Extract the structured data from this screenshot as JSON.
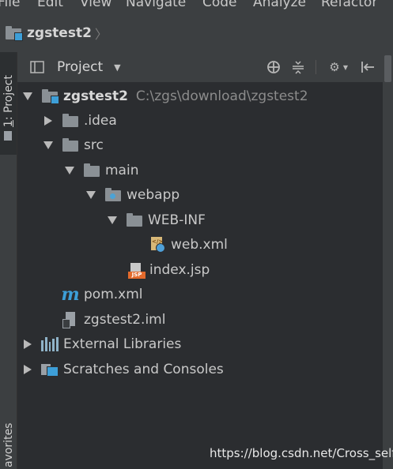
{
  "menu": [
    "File",
    "Edit",
    "View",
    "Navigate",
    "Code",
    "Analyze",
    "Refactor"
  ],
  "breadcrumb": {
    "label": "zgstest2"
  },
  "left_tabs": {
    "project_number": "1",
    "project_label": ": Project",
    "favorites_label": "avorites"
  },
  "panel": {
    "title": "Project"
  },
  "tree": [
    {
      "label": "zgstest2",
      "path": "C:\\zgs\\download\\zgstest2"
    },
    {
      "label": ".idea"
    },
    {
      "label": "src"
    },
    {
      "label": "main"
    },
    {
      "label": "webapp"
    },
    {
      "label": "WEB-INF"
    },
    {
      "label": "web.xml"
    },
    {
      "label": "index.jsp"
    },
    {
      "label": "pom.xml",
      "icon_glyph": "m"
    },
    {
      "label": "zgstest2.iml"
    },
    {
      "label": "External Libraries"
    },
    {
      "label": "Scratches and Consoles"
    }
  ],
  "jsp_badge": "JSP",
  "watermark": "https://blog.csdn.net/Cross_self",
  "colors": {
    "accent": "#3d9fd8",
    "jsp": "#e36a2c",
    "background": "#2b2d30"
  }
}
